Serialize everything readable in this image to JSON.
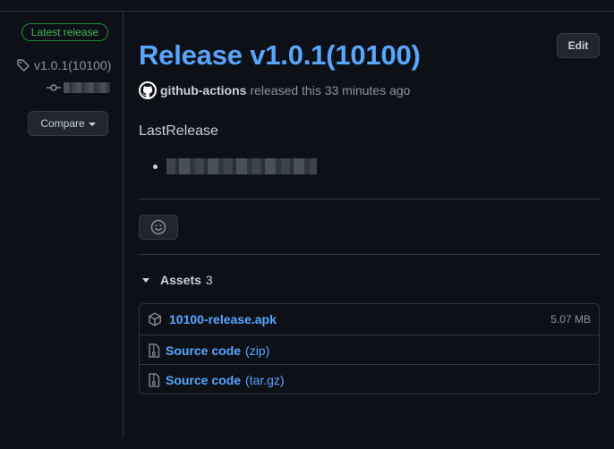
{
  "sidebar": {
    "badge": "Latest release",
    "tag": "v1.0.1(10100)",
    "compare_label": "Compare"
  },
  "release": {
    "title": "Release v1.0.1(10100)",
    "edit_label": "Edit",
    "author": "github-actions",
    "released_text": "released this 33 minutes ago",
    "body_title": "LastRelease"
  },
  "assets": {
    "label": "Assets",
    "count": "3",
    "items": [
      {
        "name": "10100-release.apk",
        "format": "",
        "size": "5.07 MB",
        "icon": "package-icon"
      },
      {
        "name": "Source code",
        "format": "(zip)",
        "size": "",
        "icon": "file-zip-icon"
      },
      {
        "name": "Source code",
        "format": "(tar.gz)",
        "size": "",
        "icon": "file-zip-icon"
      }
    ]
  },
  "colors": {
    "background": "#0d1117",
    "link": "#58a6ff",
    "success": "#3fb950",
    "muted": "#8b949e",
    "border": "#30363d"
  }
}
